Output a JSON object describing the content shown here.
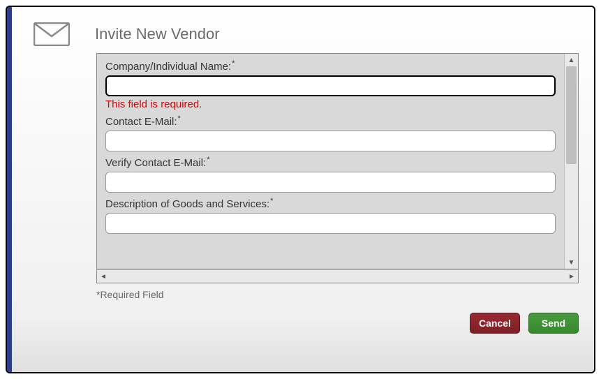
{
  "header": {
    "title": "Invite New Vendor"
  },
  "form": {
    "fields": {
      "company_name": {
        "label": "Company/Individual Name:",
        "value": "",
        "error": "This field is required."
      },
      "contact_email": {
        "label": "Contact E-Mail:",
        "value": ""
      },
      "verify_email": {
        "label": "Verify Contact E-Mail:",
        "value": ""
      },
      "description": {
        "label": "Description of Goods and Services:",
        "value": ""
      }
    },
    "required_note": "*Required Field"
  },
  "buttons": {
    "cancel": "Cancel",
    "send": "Send"
  }
}
